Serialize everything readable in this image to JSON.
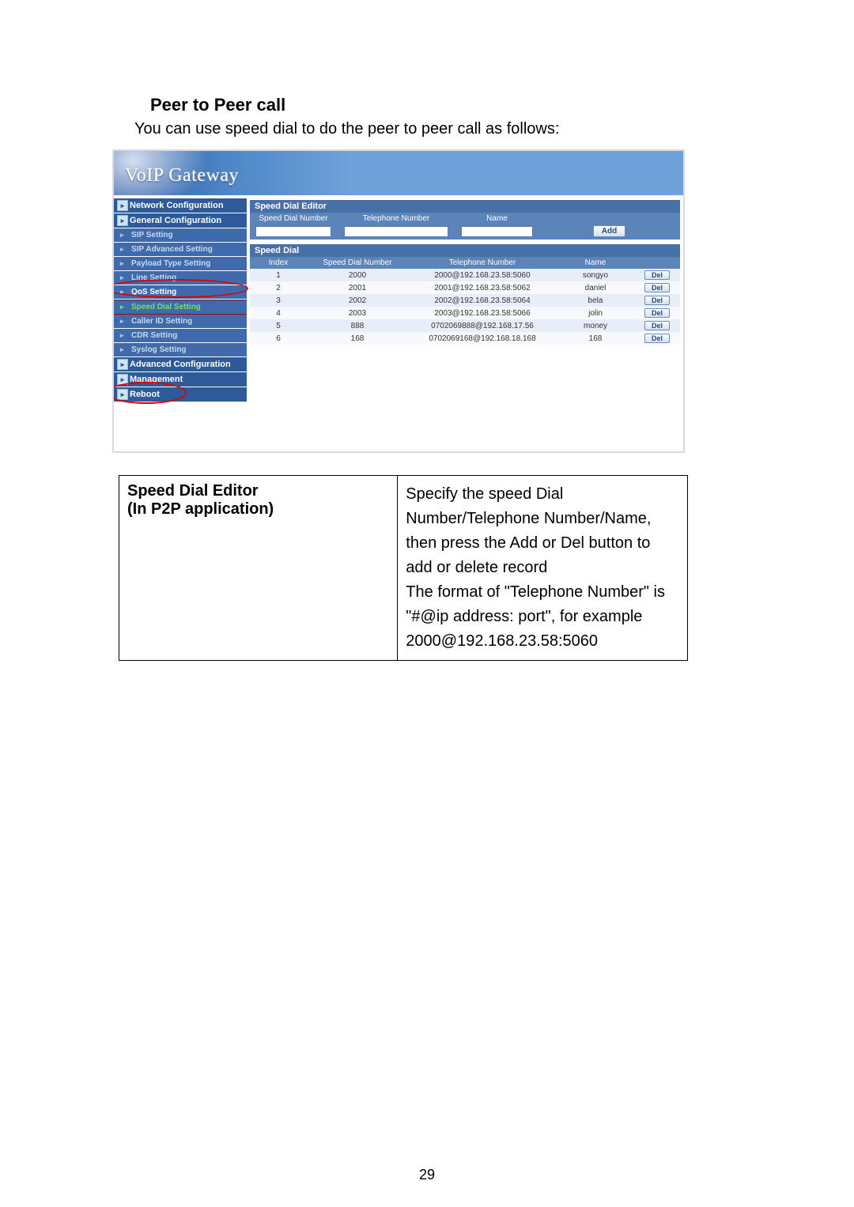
{
  "doc": {
    "section_title": "Peer to Peer call",
    "intro": "You can use speed dial to do the peer to peer call as follows:",
    "page_number": "29"
  },
  "shot": {
    "brand": "VoIP  Gateway",
    "sidebar": {
      "top": [
        "Network Configuration",
        "General Configuration"
      ],
      "subs": [
        "SIP Setting",
        "SIP Advanced Setting",
        "Payload Type Setting",
        "Line Setting",
        "QoS Setting",
        "Speed Dial Setting",
        "Caller ID Setting",
        "CDR Setting",
        "Syslog Setting"
      ],
      "bottom": [
        "Advanced Configuration",
        "Management",
        "Reboot"
      ]
    },
    "editor": {
      "title": "Speed Dial Editor",
      "col_sdn": "Speed Dial Number",
      "col_tel": "Telephone Number",
      "col_name": "Name",
      "add_btn": "Add"
    },
    "list": {
      "title": "Speed Dial",
      "th_index": "Index",
      "th_sdn": "Speed Dial Number",
      "th_tel": "Telephone Number",
      "th_name": "Name",
      "del_label": "Del",
      "rows": [
        {
          "idx": "1",
          "sdn": "2000",
          "tel": "2000@192.168.23.58:5060",
          "name": "songyo"
        },
        {
          "idx": "2",
          "sdn": "2001",
          "tel": "2001@192.168.23.58:5062",
          "name": "daniel"
        },
        {
          "idx": "3",
          "sdn": "2002",
          "tel": "2002@192.168.23.58:5064",
          "name": "bela"
        },
        {
          "idx": "4",
          "sdn": "2003",
          "tel": "2003@192.168.23.58:5066",
          "name": "jolin"
        },
        {
          "idx": "5",
          "sdn": "888",
          "tel": "0702069888@192.168.17.56",
          "name": "money"
        },
        {
          "idx": "6",
          "sdn": "168",
          "tel": "0702069168@192.168.18.168",
          "name": "168"
        }
      ]
    }
  },
  "desc": {
    "left_line1": "Speed Dial Editor",
    "left_line2": "(In P2P application)",
    "right": "Specify the speed Dial Number/Telephone Number/Name, then press the Add or Del button to add or delete record\nThe format of \"Telephone Number\" is \"#@ip address: port\", for example 2000@192.168.23.58:5060"
  }
}
